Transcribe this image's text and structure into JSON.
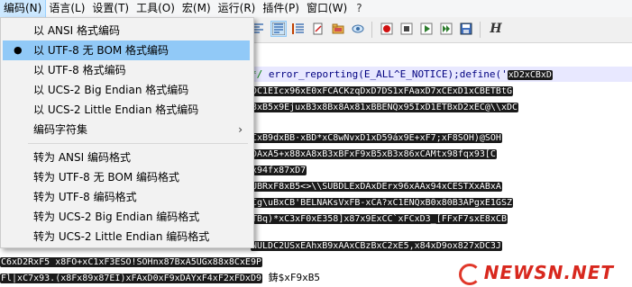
{
  "menubar": {
    "items": [
      "编码(N)",
      "语言(L)",
      "设置(T)",
      "工具(O)",
      "宏(M)",
      "运行(R)",
      "插件(P)",
      "窗口(W)",
      "?"
    ]
  },
  "toolbar": {
    "icons": [
      "align-icon",
      "wrap-icon",
      "indent-icon",
      "doc-icon",
      "folder-icon",
      "eye-icon",
      "record-icon",
      "stop-icon",
      "play-icon",
      "play-multiple-icon",
      "save-macro-icon",
      "H-icon"
    ]
  },
  "encoding_menu": {
    "items": [
      {
        "label": "以 ANSI 格式编码",
        "selected": false
      },
      {
        "label": "以 UTF-8 无 BOM 格式编码",
        "selected": true
      },
      {
        "label": "以 UTF-8 格式编码",
        "selected": false
      },
      {
        "label": "以 UCS-2 Big Endian 格式编码",
        "selected": false
      },
      {
        "label": "以 UCS-2 Little Endian 格式编码",
        "selected": false
      },
      {
        "label": "编码字符集",
        "submenu": true
      }
    ],
    "convert_items": [
      {
        "label": "转为 ANSI 编码格式"
      },
      {
        "label": "转为 UTF-8 无 BOM 编码格式"
      },
      {
        "label": "转为 UTF-8 编码格式"
      },
      {
        "label": "转为 UCS-2 Big Endian 编码格式"
      },
      {
        "label": "转为 UCS-2 Little Endian 编码格式"
      }
    ],
    "bullet": "●",
    "arrow": "›"
  },
  "editor": {
    "line1": {
      "comment": "*/",
      "code": "error_reporting(E_ALL^E_NOTICE);define('",
      "ctl": "xD2xCBxD"
    },
    "line2": "DC1EIcx96xE0xFCACKzqDxD7DS1xFAaxD7xCExD1xCBETBtG",
    "line3": "8xB5x9EjuxB3x8Bx8Ax81xBBENQx95IxD1ETBxD2xEC@\\\\xDC",
    "line4": "CxB9dxBB·xBD*xC8wNvxD1xD59áx9E+xF7;xF8SOH)@SOH",
    "line5": "DAxA5+x88xA8xB3xBFxF9xB5xB3x86xCAMtx98fqx93[C",
    "line6": "x94fx87xD7",
    "line7": "UBRxF8xB5<>\\\\SUBDLExDAxDErx96xAAx94xCESTXxABxA",
    "line8": "Cg\\uBxCB'BELNAKsVxFB-xCA?xC1ENQxB0x80B3APgxE1GSZ",
    "line9": "TBq)*xC3xF0xE358]x87x9ExCC`xFCxD3_[FFxF7sxE8xCB",
    "line10": "NULDC2USxEAhxB9xAAxCBzBxC2xE5,x84xD9ox827xDC3J",
    "line11": "C6xD2RxF5 x8FO+xC1xF3ESO!SOHnx87BxA5UGx88x8CxE9P",
    "line12": "Fl|xC7x93.(x8Fx89x87EI)xFAxD0xF9xDAYxF4xF2xFDxD9",
    "line12_tail": "鋳$xF9xB5"
  },
  "watermark": {
    "text": "NEWSN.NET"
  }
}
